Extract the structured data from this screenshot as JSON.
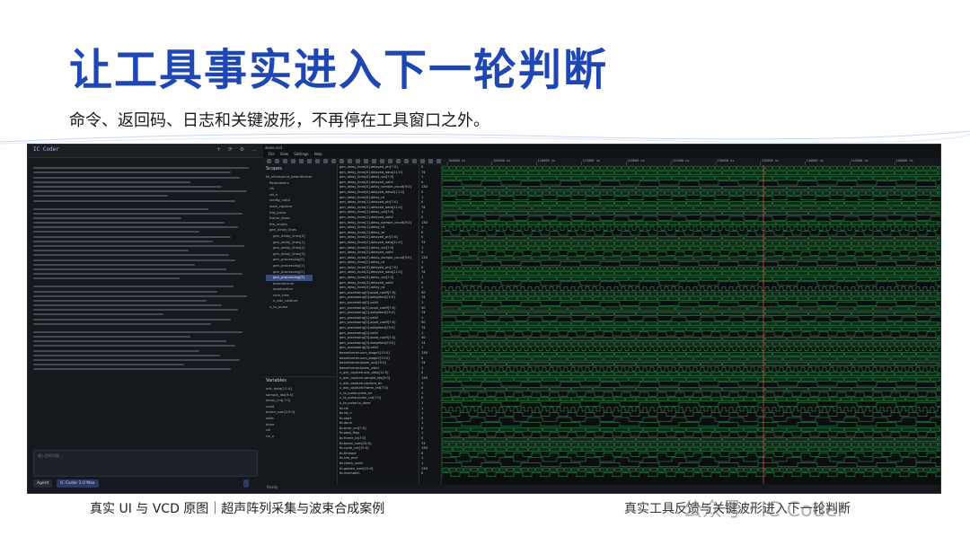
{
  "slide": {
    "title": "让工具事实进入下一轮判断",
    "subtitle": "命令、返回码、日志和关键波形，不再停在工具窗口之外。",
    "caption_left": "真实 UI 与 VCD 原图｜超声阵列采集与波束合成案例",
    "caption_right": "真实工具反馈与关键波形进入下一轮判断",
    "watermark": "公众号 · IC Coder"
  },
  "chat_panel": {
    "app_name": "IC Coder",
    "input_placeholder": "输入您的问题…",
    "footer": {
      "agent_label": "Agent",
      "model_label": "IC Coder 2.0 Max"
    }
  },
  "wave_app": {
    "tab_label": "wave.vcd",
    "menu": [
      "File",
      "View",
      "Settings",
      "Help"
    ],
    "scopes_title": "Scopes",
    "variables_title": "Variables",
    "scopes": [
      "tb_ultrasound_beamformer",
      "Parameters",
      "clk",
      "rst_n",
      "config_valid",
      "start_capture",
      "trig_pulse",
      "frame_done",
      "fifo_empty",
      "gen_delay_lines",
      "gen_delay_lines[0]",
      "gen_delay_lines[1]",
      "gen_delay_lines[2]",
      "gen_delay_lines[3]",
      "gen_processing[0]",
      "gen_processing[1]",
      "gen_processing[2]",
      "gen_processing[3]",
      "beamformer",
      "apodization",
      "sum_tree",
      "u_adc_capture",
      "u_tx_pulse"
    ],
    "variables": [
      "adc_data[11:0]",
      "sample_idx[9:0]",
      "delay_cnt[7:0]",
      "valid",
      "beam_sum[15:0]",
      "start",
      "done",
      "clk",
      "rst_n"
    ],
    "signals": [
      "gen_delay_lines[0].delayed_ptr[7:0]",
      "gen_delay_lines[0].delayed_data[11:0]",
      "gen_delay_lines[0].delay_val[7:0]",
      "gen_delay_lines[0].delayed_valid",
      "gen_delay_lines[0].delay_sample_count[9:0]",
      "gen_delay_lines[0].delayed_data2[11:0]",
      "gen_delay_lines[0].delay_rd",
      "gen_delay_lines[1].delayed_ptr[7:0]",
      "gen_delay_lines[1].delayed_data[11:0]",
      "gen_delay_lines[1].delay_val[7:0]",
      "gen_delay_lines[1].delayed_valid",
      "gen_delay_lines[1].delay_sample_count[9:0]",
      "gen_delay_lines[1].delay_rd",
      "gen_delay_lines[1].delay_wr",
      "gen_delay_lines[2].delayed_ptr[7:0]",
      "gen_delay_lines[2].delayed_data[11:0]",
      "gen_delay_lines[2].delay_val[7:0]",
      "gen_delay_lines[2].delayed_valid",
      "gen_delay_lines[2].delay_sample_count[9:0]",
      "gen_delay_lines[2].delay_rd",
      "gen_delay_lines[3].delayed_ptr[7:0]",
      "gen_delay_lines[3].delayed_data[11:0]",
      "gen_delay_lines[3].delay_val[7:0]",
      "gen_delay_lines[3].delayed_valid",
      "gen_delay_lines[3].delay_rd",
      "gen_processing[0].apod_coeff[7:0]",
      "gen_processing[0].weighted[15:0]",
      "gen_processing[0].valid",
      "gen_processing[1].apod_coeff[7:0]",
      "gen_processing[1].weighted[15:0]",
      "gen_processing[1].valid",
      "gen_processing[2].apod_coeff[7:0]",
      "gen_processing[2].weighted[15:0]",
      "gen_processing[2].valid",
      "gen_processing[3].apod_coeff[7:0]",
      "gen_processing[3].weighted[15:0]",
      "gen_processing[3].valid",
      "beamformer.sum_stage1[15:0]",
      "beamformer.sum_stage2[15:0]",
      "beamformer.beam_out[15:0]",
      "beamformer.beam_valid",
      "u_adc_capture.adc_data[11:0]",
      "u_adc_capture.sample_idx[9:0]",
      "u_adc_capture.capture_en",
      "u_adc_capture.frame_cnt[7:0]",
      "u_tx_pulse.pulse_en",
      "u_tx_pulse.pulse_cnt[7:0]",
      "u_tx_pulse.tx_done",
      "tb.clk",
      "tb.rst_n",
      "tb.start",
      "tb.done",
      "tb.error_cnt[7:0]",
      "tb.pass_flag",
      "tb.frame_id[7:0]",
      "tb.beam_sum[15:0]",
      "tb.cycle_cnt[15:0]",
      "tb.timeout",
      "tb.sim_end",
      "tb.check_valid",
      "tb.golden_sum[15:0]",
      "tb.mismatch"
    ],
    "values": [
      "0",
      "74",
      "1",
      "0",
      "130",
      "0",
      "1",
      "0",
      "74",
      "1",
      "0",
      "130",
      "1",
      "0",
      "0",
      "74",
      "1",
      "0",
      "130",
      "1",
      "0",
      "74",
      "1",
      "0",
      "1",
      "50",
      "74",
      "1",
      "50",
      "74",
      "1",
      "50",
      "74",
      "1",
      "50",
      "74",
      "1",
      "130",
      "0",
      "74",
      "1",
      "0",
      "130",
      "1",
      "0",
      "1",
      "0",
      "1",
      "1",
      "1",
      "0",
      "1",
      "0",
      "1",
      "0",
      "74",
      "130",
      "0",
      "1",
      "1",
      "130",
      "0"
    ],
    "ruler_labels": [
      "100000 ns",
      "105000 ns",
      "110000 ns",
      "115000 ns",
      "120000 ns",
      "125000 ns",
      "130000 ns",
      "135000 ns",
      "140000 ns",
      "145000 ns",
      "150000 ns"
    ],
    "status_text": "Ready"
  }
}
